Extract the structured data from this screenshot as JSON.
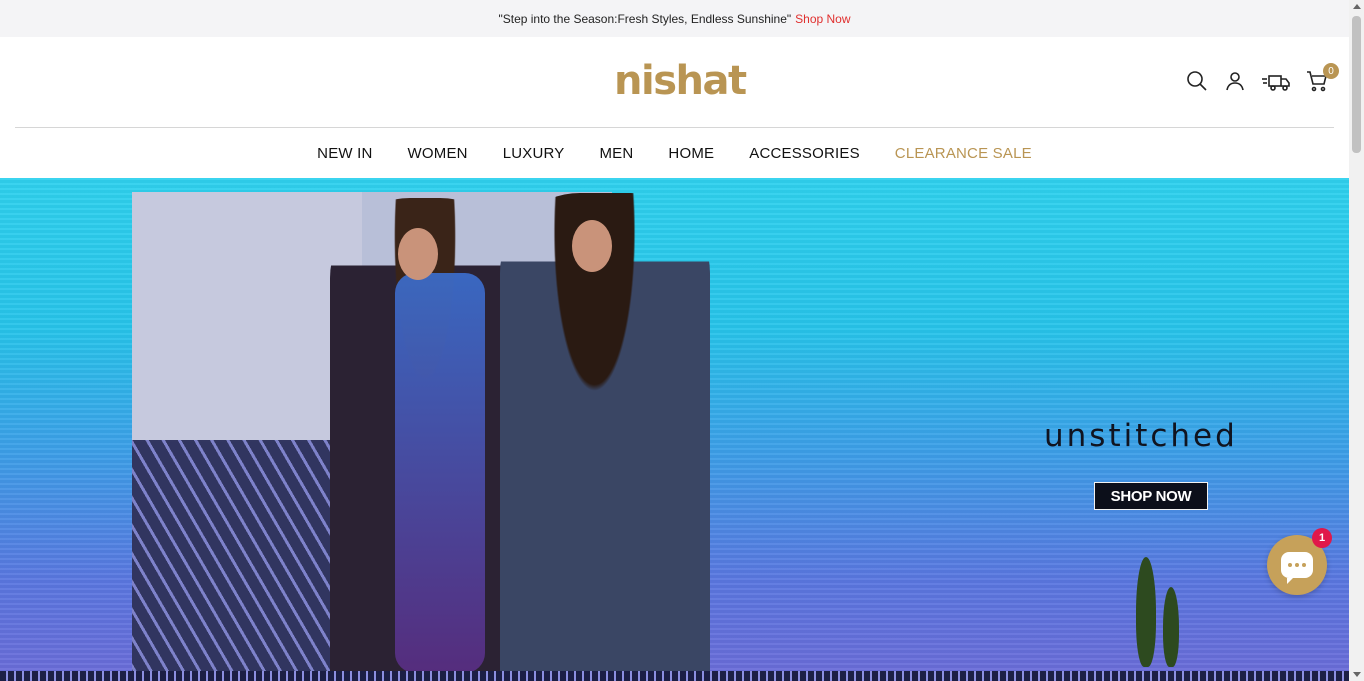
{
  "announcement": {
    "text": "\"Step into the Season:Fresh Styles, Endless Sunshine\"",
    "link_label": "Shop Now"
  },
  "header": {
    "logo_text": "nishat",
    "icons": [
      "search-icon",
      "account-icon",
      "delivery-truck-icon",
      "cart-icon"
    ],
    "cart_count": "0"
  },
  "nav": {
    "items": [
      {
        "label": "NEW IN"
      },
      {
        "label": "WOMEN"
      },
      {
        "label": "LUXURY"
      },
      {
        "label": "MEN"
      },
      {
        "label": "HOME"
      },
      {
        "label": "ACCESSORIES"
      },
      {
        "label": "CLEARANCE SALE"
      }
    ]
  },
  "hero": {
    "title": "unstitched",
    "cta_label": "SHOP NOW"
  },
  "chat": {
    "icon": "chat-icon",
    "badge_count": "1"
  },
  "colors": {
    "brand_gold": "#b99553",
    "link_red": "#e0302f",
    "badge_pink": "#e0184a"
  }
}
